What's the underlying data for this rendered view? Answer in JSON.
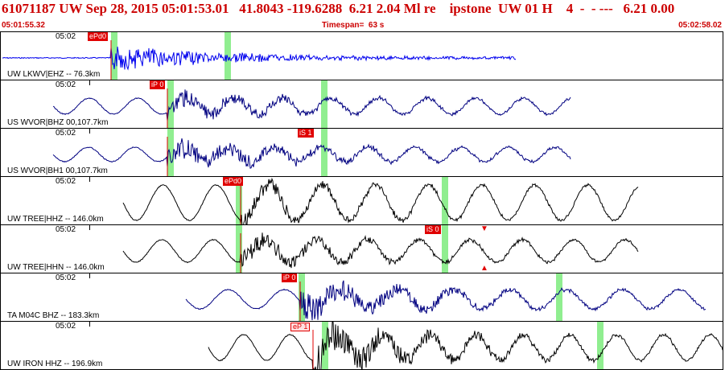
{
  "header": {
    "title": "61071187 UW Sep 28, 2015 05:01:53.01   41.8043 -119.6288  6.21 2.04 Ml re    ipstone  UW 01 H    4  -  - ---   6.21 0.00",
    "start_time": "05:01:55.32",
    "timespan": "Timespan=  63 s",
    "end_time": "05:02:58.02"
  },
  "colors": {
    "title": "#cc0000",
    "pick": "#e00000",
    "marker": "#90ee90"
  },
  "panels": [
    {
      "tick": "05:02",
      "label": "UW LKWV|EHZ -- 76.3km",
      "pick": "ePd0",
      "wave_color": "#0000ee",
      "style": "noise"
    },
    {
      "tick": "05:02",
      "label": "US WVOR|BHZ 00,107.7km",
      "pick": "iP 0",
      "wave_color": "#000080",
      "style": "mixed"
    },
    {
      "tick": "05:02",
      "label": "US WVOR|BH1 00,107.7km",
      "pick": "iS 1",
      "wave_color": "#000080",
      "style": "mixed"
    },
    {
      "tick": "05:02",
      "label": "UW TREE|HHZ -- 146.0km",
      "pick": "ePd0",
      "wave_color": "#000000",
      "style": "wave"
    },
    {
      "tick": "05:02",
      "label": "UW TREE|HHN -- 146.0km",
      "pick": "iS 0",
      "wave_color": "#000000",
      "style": "wave"
    },
    {
      "tick": "05:02",
      "label": "TA M04C BHZ -- 183.3km",
      "pick": "iP 0",
      "wave_color": "#000080",
      "style": "mixed"
    },
    {
      "tick": "05:02",
      "label": "UW IRON HHZ -- 196.9km",
      "pick": "eP 1",
      "wave_color": "#000000",
      "style": "mixed"
    }
  ]
}
